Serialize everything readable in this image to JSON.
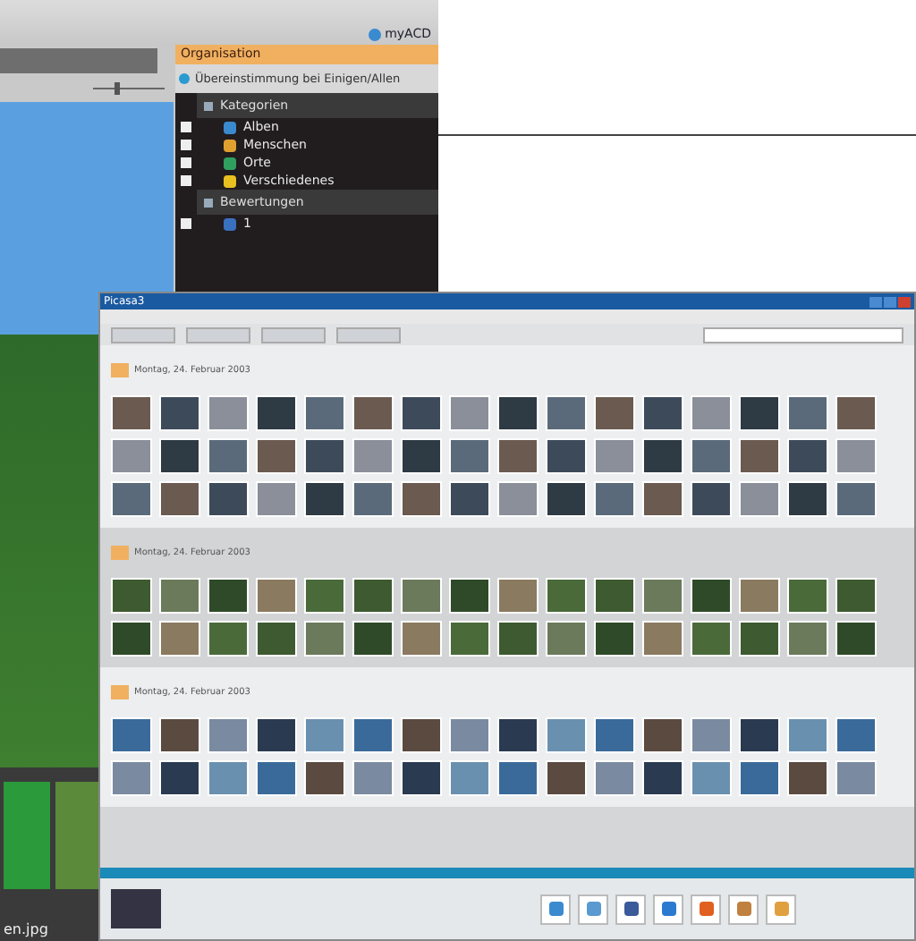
{
  "acdsee": {
    "top_button": "myACD",
    "panel_title": "Organisation",
    "match_option": "Übereinstimmung bei Einigen/Allen",
    "groups": [
      {
        "title": "Kategorien",
        "items": [
          {
            "label": "Alben",
            "checked": false
          },
          {
            "label": "Menschen",
            "checked": false
          },
          {
            "label": "Orte",
            "checked": false
          },
          {
            "label": "Verschiedenes",
            "checked": false
          }
        ]
      },
      {
        "title": "Bewertungen",
        "items": [
          {
            "label": "1",
            "checked": false
          }
        ]
      }
    ],
    "filmstrip_caption": "en.jpg",
    "zoom_slider": {
      "level": 0.3
    }
  },
  "picasa": {
    "title": "Picasa3",
    "sections": [
      {
        "date": "Montag, 24. Februar 2003"
      },
      {
        "date": "Montag, 24. Februar 2003"
      },
      {
        "date": "Montag, 24. Februar 2003"
      }
    ]
  }
}
